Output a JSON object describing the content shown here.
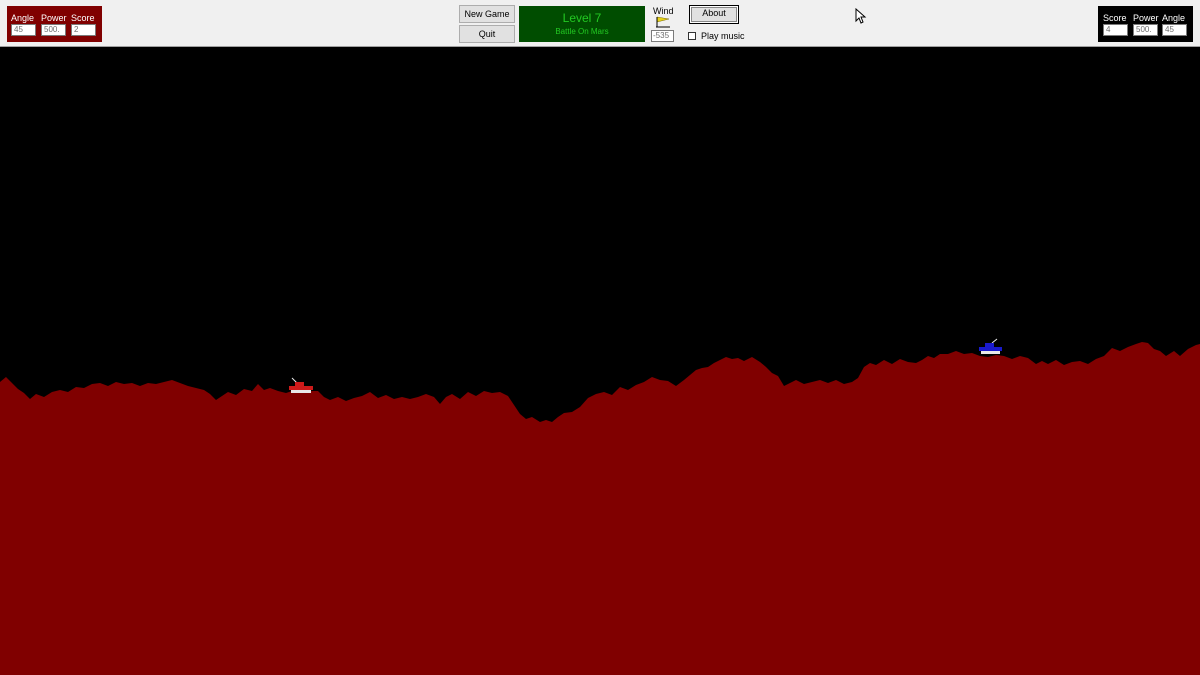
{
  "player1": {
    "color": "#800000",
    "angle_label": "Angle",
    "angle_value": "45",
    "power_label": "Power",
    "power_value": "500.",
    "score_label": "Score",
    "score_value": "2"
  },
  "player2": {
    "color": "#000000",
    "score_label": "Score",
    "score_value": "4",
    "power_label": "Power",
    "power_value": "500.",
    "angle_label": "Angle",
    "angle_value": "45"
  },
  "buttons": {
    "new_game_label": "New Game",
    "quit_label": "Quit",
    "about_label": "About"
  },
  "level": {
    "title": "Level 7",
    "subtitle": "Battle On Mars",
    "background_color": "#004d00",
    "text_color": "#22c922"
  },
  "wind": {
    "label": "Wind",
    "value": "-535",
    "icon": "wind-flag-icon"
  },
  "music": {
    "label": "Play music",
    "checked": false
  },
  "battlefield": {
    "sky_color": "#000000",
    "ground_color": "#800000",
    "player1_tank_color": "#cc1a1a",
    "player2_tank_color": "#1a1acc"
  }
}
